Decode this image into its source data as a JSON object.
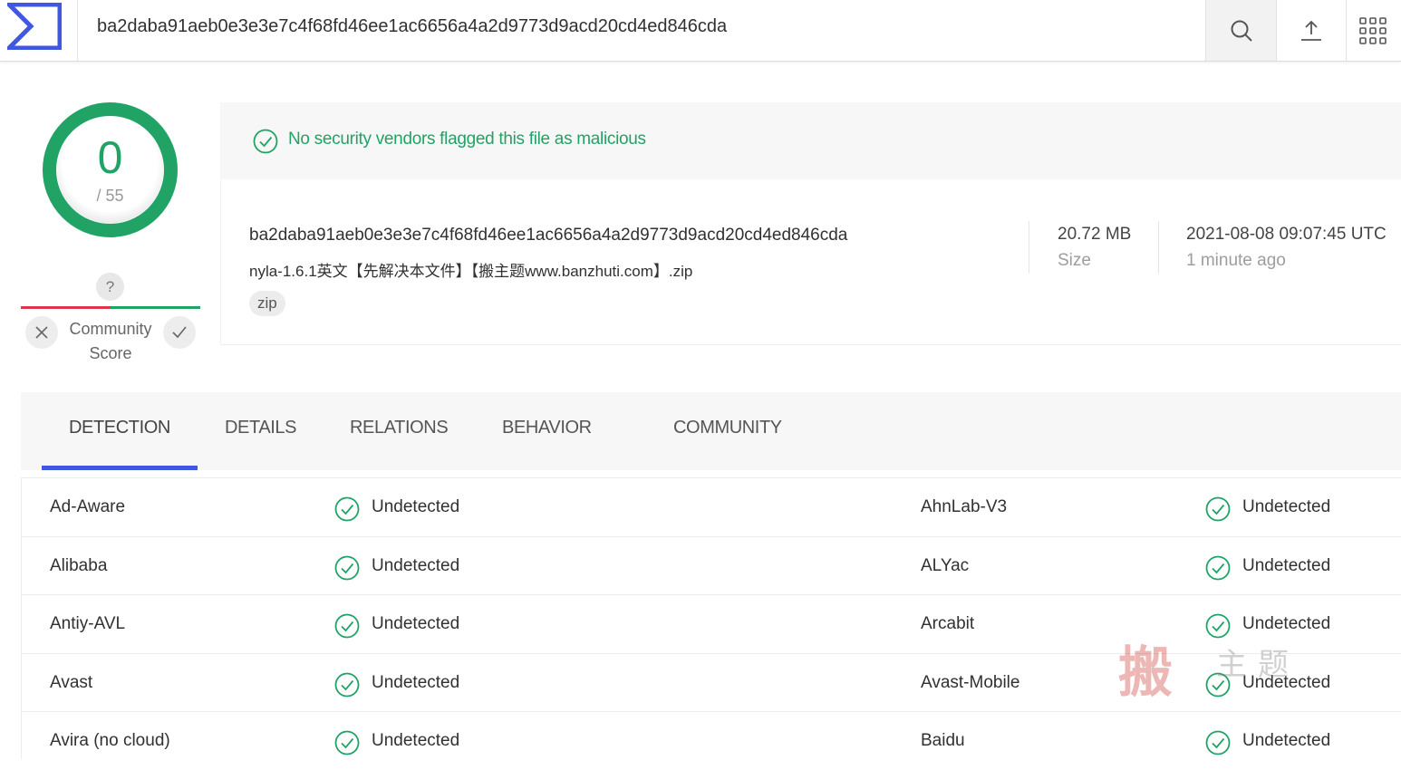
{
  "topbar": {
    "search_value": "ba2daba91aeb0e3e3e7c4f68fd46ee1ac6656a4a2d9773d9acd20cd4ed846cda"
  },
  "score": {
    "detections": "0",
    "total": "/ 55",
    "fraction_malicious": 0
  },
  "community": {
    "unknown_glyph": "?",
    "label_line1": "Community",
    "label_line2": "Score"
  },
  "banner": {
    "message": "No security vendors flagged this file as malicious"
  },
  "file": {
    "hash": "ba2daba91aeb0e3e3e7c4f68fd46ee1ac6656a4a2d9773d9acd20cd4ed846cda",
    "name": "nyla-1.6.1英文【先解决本文件】【搬主题www.banzhuti.com】.zip",
    "tag": "zip",
    "size_value": "20.72 MB",
    "size_label": "Size",
    "date_value": "2021-08-08 09:07:45 UTC",
    "date_label": "1 minute ago"
  },
  "tabs": [
    {
      "label": "DETECTION",
      "active": true
    },
    {
      "label": "DETAILS",
      "active": false
    },
    {
      "label": "RELATIONS",
      "active": false
    },
    {
      "label": "BEHAVIOR",
      "active": false
    },
    {
      "label": "COMMUNITY",
      "active": false
    }
  ],
  "detections": [
    {
      "left_vendor": "Ad-Aware",
      "left_result": "Undetected",
      "right_vendor": "AhnLab-V3",
      "right_result": "Undetected"
    },
    {
      "left_vendor": "Alibaba",
      "left_result": "Undetected",
      "right_vendor": "ALYac",
      "right_result": "Undetected"
    },
    {
      "left_vendor": "Antiy-AVL",
      "left_result": "Undetected",
      "right_vendor": "Arcabit",
      "right_result": "Undetected"
    },
    {
      "left_vendor": "Avast",
      "left_result": "Undetected",
      "right_vendor": "Avast-Mobile",
      "right_result": "Undetected"
    },
    {
      "left_vendor": "Avira (no cloud)",
      "left_result": "Undetected",
      "right_vendor": "Baidu",
      "right_result": "Undetected"
    }
  ],
  "watermark": {
    "main": "搬",
    "side": "主题"
  },
  "colors": {
    "green": "#21a366",
    "red": "#e0344b",
    "blue": "#3f57e1"
  },
  "icons": {
    "logo": "virustotal-sigma-logo",
    "search": "search-icon",
    "upload": "upload-icon",
    "apps": "apps-grid-icon",
    "ok": "check-circle-icon"
  }
}
